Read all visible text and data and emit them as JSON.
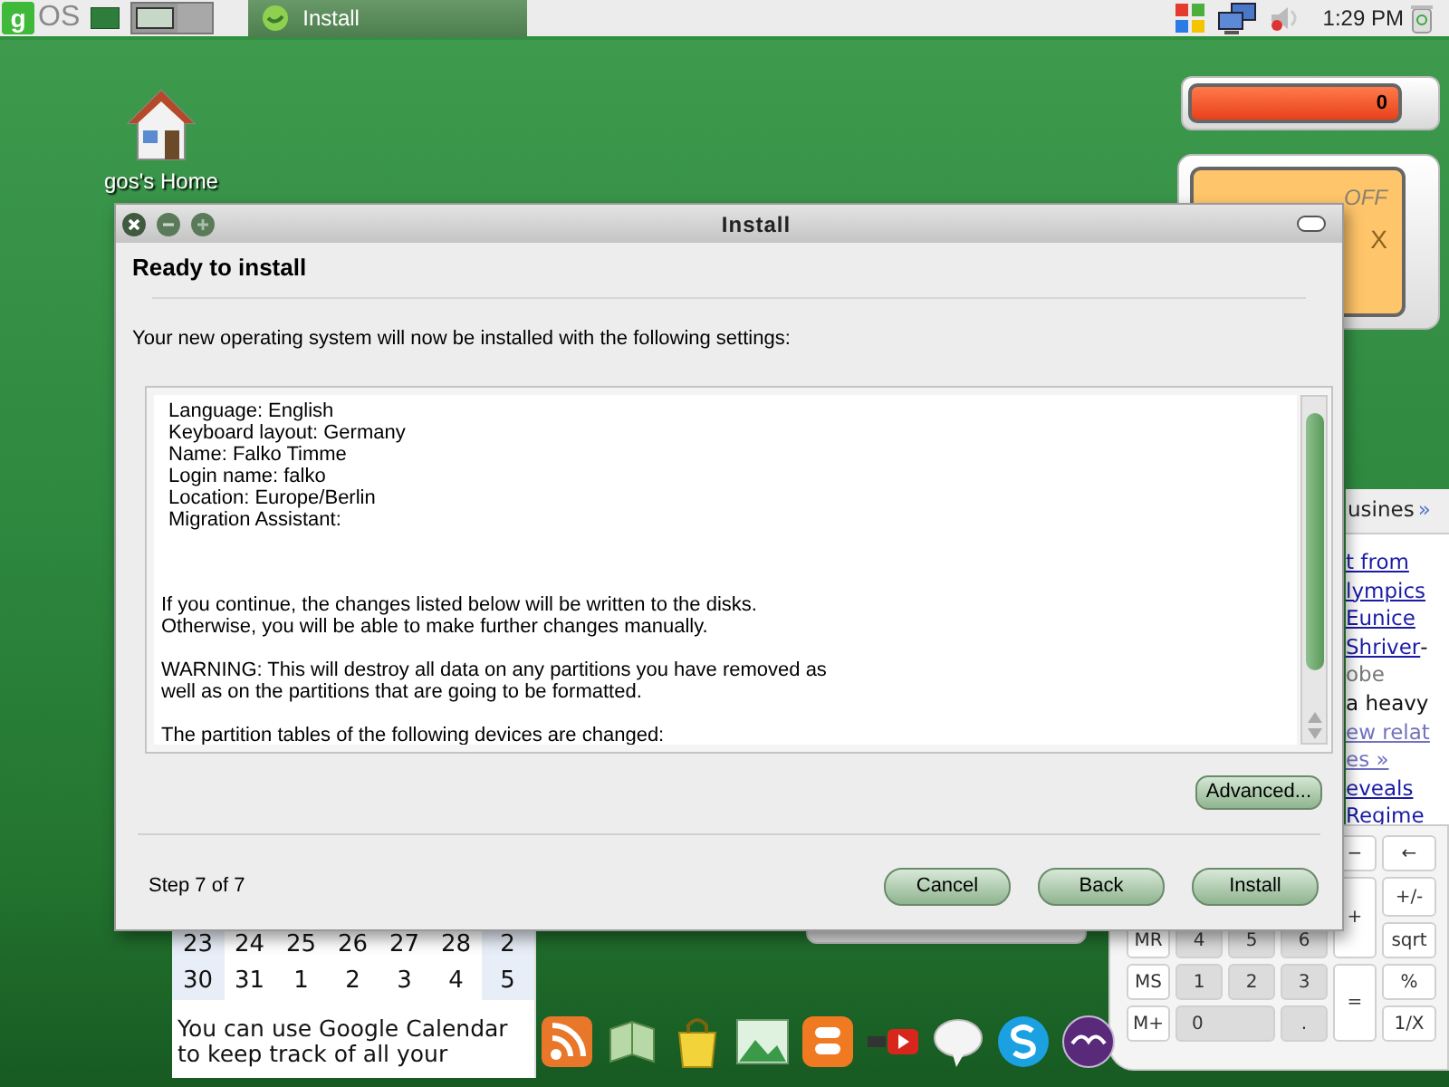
{
  "top_panel": {
    "logo": "g",
    "os_label": "OS",
    "workspaces": [
      {
        "selected": true
      },
      {
        "selected": false
      }
    ],
    "taskbar": [
      {
        "label": "Install",
        "selected": true
      }
    ],
    "clock": "1:29 PM"
  },
  "desktop_icons": [
    {
      "label": "gos's Home"
    }
  ],
  "counter_widget": {
    "value": "0"
  },
  "switch_widget": {
    "state": "OFF",
    "button": "X"
  },
  "news_widget": {
    "heading": "usines",
    "more": "»",
    "lines": [
      {
        "kind": "link",
        "text": "t from"
      },
      {
        "kind": "link",
        "text": "lympics "
      },
      {
        "kind": "link",
        "text": "Eunice"
      },
      {
        "kind": "link",
        "text": "Shriver",
        "suffix": " -"
      },
      {
        "kind": "muted",
        "text": "obe"
      },
      {
        "kind": "text",
        "text": "a heavy"
      },
      {
        "kind": "visited",
        "text": "ew relat"
      },
      {
        "kind": "visited",
        "text": "es »"
      },
      {
        "kind": "link",
        "text": "eveals"
      },
      {
        "kind": "link",
        "text": "Regime"
      }
    ]
  },
  "calendar_widget": {
    "weeks": [
      [
        "23",
        "24",
        "25",
        "26",
        "27",
        "28",
        "2"
      ],
      [
        "30",
        "31",
        "1",
        "2",
        "3",
        "4",
        "5"
      ]
    ],
    "note": "You can use Google Calendar to keep track of all your"
  },
  "calculator": {
    "keys": [
      "−",
      "←",
      "+",
      "+/-",
      "MR",
      "4",
      "5",
      "6",
      "sqrt",
      "MS",
      "1",
      "2",
      "3",
      "=",
      "%",
      "M+",
      "0",
      ".",
      "1/X"
    ]
  },
  "dialog": {
    "title": "Install",
    "heading": "Ready to install",
    "intro": "Your new operating system will now be installed with the following settings:",
    "summary": [
      [
        "Language: English",
        "Keyboard layout: Germany",
        "Name: Falko Timme",
        "Login name: falko",
        "Location: Europe/Berlin",
        "Migration Assistant:"
      ],
      [
        "If you continue, the changes listed below will be written to the disks.",
        "Otherwise, you will be able to make further changes manually."
      ],
      [
        "WARNING: This will destroy all data on any partitions you have removed as",
        "well as on the partitions that are going to be formatted."
      ],
      [
        "The partition tables of the following devices are changed:"
      ]
    ],
    "advanced_button": "Advanced...",
    "step": "Step 7 of 7",
    "buttons": [
      "Cancel",
      "Back",
      "Install"
    ]
  }
}
